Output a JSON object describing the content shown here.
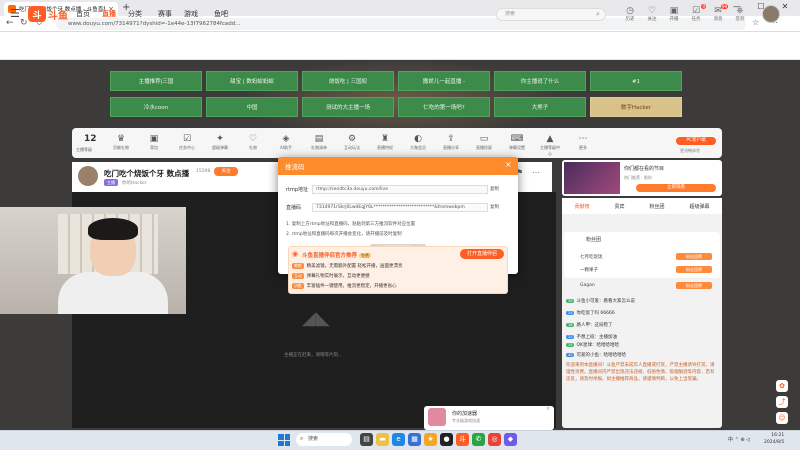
{
  "browser": {
    "tab_title": "吃门吃个烧饭个牙 数点播 - 斗鱼直播 - ...",
    "url": "www.douyu.com/7314971?dyshid=-1e44e-13f7962784fcadd...",
    "win_minimize": "—",
    "win_maximize": "☐",
    "win_close": "✕"
  },
  "site": {
    "logo_text": "斗鱼",
    "nav": [
      "首页",
      "直播",
      "分类",
      "赛事",
      "游戏",
      "鱼吧"
    ],
    "search_placeholder": "搜索",
    "header_icons": [
      {
        "label": "历史",
        "icon": "clock-icon"
      },
      {
        "label": "关注",
        "icon": "heart-icon"
      },
      {
        "label": "开播",
        "icon": "camera-icon"
      },
      {
        "label": "任务",
        "icon": "task-icon",
        "badge": "9"
      },
      {
        "label": "消息",
        "icon": "message-icon",
        "badge": "99"
      },
      {
        "label": "签到",
        "icon": "gift-icon"
      }
    ]
  },
  "tags": [
    [
      "主播推荐|三国",
      "甜宝 | 数蚂蚁蚂蚁",
      "烧饭吃 | 三国权",
      "撒娇儿一起直播 -",
      "你主播说了什么",
      "#1"
    ],
    [
      "冷水coon",
      "中国",
      "测试的大主播一场",
      "仁吃的第一场吧?",
      "大熊子",
      "数字Hacker"
    ]
  ],
  "room_toolbar": {
    "rank": "12",
    "rank_label": "主播等级",
    "items": [
      "贡献礼物",
      "背包",
      "任务中心",
      "超级弹幕",
      "礼物",
      "AI助手",
      "礼物清单",
      "互动玩法",
      "直播特权",
      "大咖会员",
      "直播分享",
      "直播投屏",
      "弹幕设置",
      "主播等级中心",
      "更多"
    ],
    "pc_client": "PC客户端",
    "pc_sub": "更流畅体验"
  },
  "room": {
    "title": "吃门吃个烧饭个牙 数点播",
    "room_id": "15598",
    "follow": "关注",
    "sub_badge": "主播",
    "sub_text": "你的Hacker"
  },
  "player": {
    "hint": "主播正在赶来，请稍等片刻..."
  },
  "ad": {
    "title": "你的加速器",
    "sub": "专业级游戏加速"
  },
  "promo": {
    "title": "你们都在看的节目",
    "sub": "热门推荐 · 限时",
    "button": "立即观看"
  },
  "chat": {
    "tabs": [
      "贡献榜",
      "贵宾",
      "粉丝团",
      "超级弹幕"
    ],
    "fan_title": "粉丝团",
    "fans": [
      {
        "name": "七月吃饭饭",
        "badge": "粉丝团牌"
      },
      {
        "name": "一颗果子",
        "badge": "粉丝团牌"
      },
      {
        "name": "Gagan",
        "badge": "粉丝团牌"
      }
    ],
    "lines": [
      {
        "lvl": "30",
        "text": "斗鱼小可爱：看看大家怎么说"
      },
      {
        "lvl": "25",
        "text": "你吃饭了吗 66666"
      },
      {
        "lvl": "18",
        "text": "路人甲：这局稳了"
      },
      {
        "lvl": "22",
        "text": "不想上班：主播加油"
      },
      {
        "lvl": "15",
        "text": "OK星球：哈哈哈哈哈"
      },
      {
        "lvl": "40",
        "text": "可爱的小鱼：哈哈哈哈哈"
      }
    ],
    "notice": "欢迎来到本直播间！斗鱼严禁未成年人直播或打赏，严禁主播诱导打赏，请理性消费。直播间内严禁出现违法违规、低俗色情、吸烟酗酒等内容，若有违反，请及时举报。如主播推荐商品，请谨慎判断，以免上当受骗。"
  },
  "modal": {
    "title": "推流码",
    "addr_label": "rtmp地址",
    "addr_value": "rtmp://sendtc3a.douyu.com/live",
    "code_label": "直播码",
    "code_value": "7314971rSkrj0LwdEqJY6L***************************&fromwebpm",
    "copy": "复制",
    "tip1": "1. 复制上方rtmp地址和直播码，粘贴到第三方推流软件对应位置",
    "tip2": "2. rtmp地址和直播码每次开播会变化，请开播前及时复制",
    "gray_btn": "已复制推流码",
    "promo_title": "斗鱼直播伴侣官方推荐",
    "promo_tag": "免费",
    "open_btn": "打开直播伴侣",
    "rows": [
      {
        "pill": "美颜",
        "text": "精美滤镜，无需额外配置 轻松开播，画面更漂亮"
      },
      {
        "pill": "互动",
        "text": "弹幕礼物实时展示，互动更便捷"
      },
      {
        "pill": "功能",
        "text": "丰富插件一键使用，推流更稳定，开播更省心"
      }
    ]
  },
  "taskbar": {
    "search": "搜索",
    "tray": "中 ⌃ ⊕ ◁",
    "time": "16:21",
    "date": "2024/8/5"
  }
}
